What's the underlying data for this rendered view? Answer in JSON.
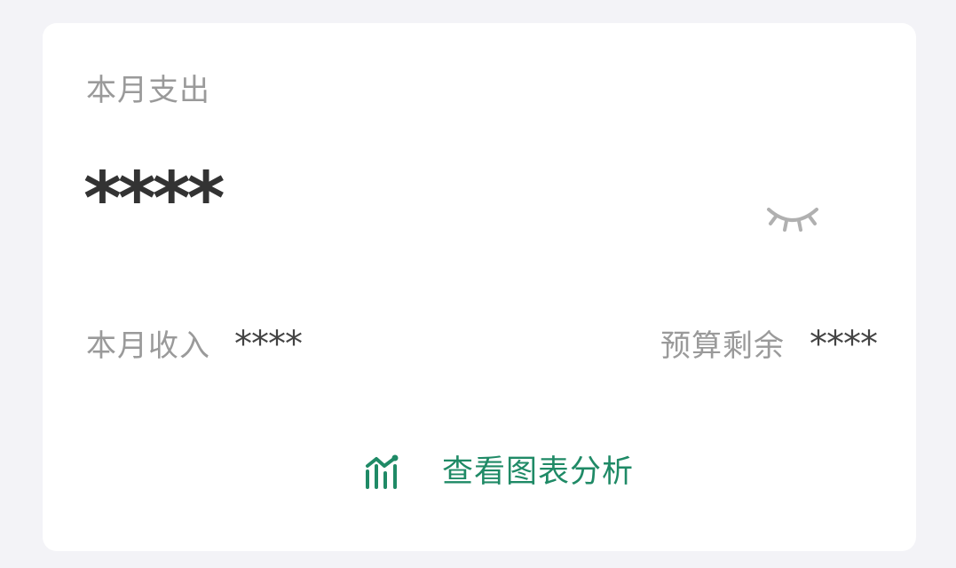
{
  "card": {
    "expense_label": "本月支出",
    "expense_amount": "****",
    "visibility_icon": "eye-closed-icon",
    "income_label": "本月收入",
    "income_value": "****",
    "budget_label": "预算剩余",
    "budget_value": "****",
    "chart_link_icon": "chart-icon",
    "chart_link_label": "查看图表分析"
  },
  "colors": {
    "background": "#f3f3f7",
    "card": "#ffffff",
    "label": "#9a9a9a",
    "amount": "#333333",
    "accent": "#1f8a66"
  }
}
